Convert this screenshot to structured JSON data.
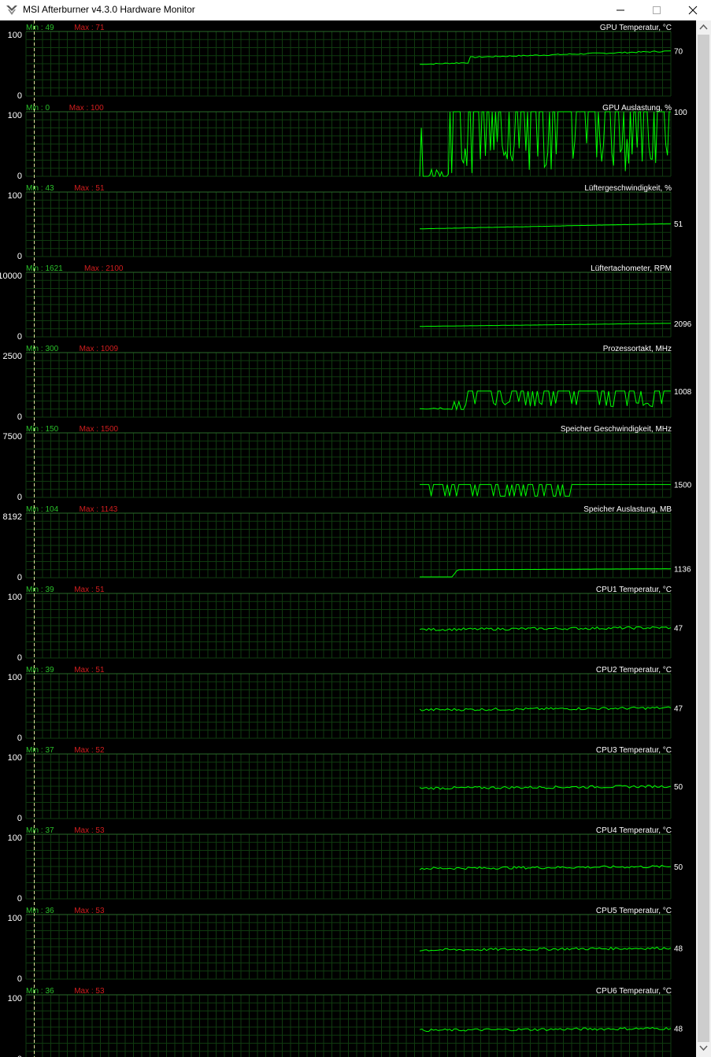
{
  "window": {
    "title": "MSI Afterburner v4.3.0 Hardware Monitor",
    "controls": {
      "minimize": "minimize",
      "maximize": "maximize",
      "close": "close"
    }
  },
  "colors": {
    "background": "#000000",
    "grid": "#0f3a0f",
    "line": "#00ff00",
    "min_text": "#29c029",
    "max_text": "#d21e1e",
    "label_text": "#ffffff"
  },
  "monitor": {
    "min_prefix": "Min : ",
    "max_prefix": "Max : ",
    "graphs": [
      {
        "name": "GPU Temperatur, °C",
        "min": "49",
        "max": "71",
        "scale_top": "100",
        "scale_bottom": "0",
        "current": "70",
        "current_value": 70,
        "range": [
          0,
          100
        ],
        "shape": "temp"
      },
      {
        "name": "GPU Auslastung, %",
        "min": "0",
        "max": "100",
        "scale_top": "100",
        "scale_bottom": "0",
        "current": "100",
        "current_value": 100,
        "range": [
          0,
          100
        ],
        "shape": "usage"
      },
      {
        "name": "Lüftergeschwindigkeit, %",
        "min": "43",
        "max": "51",
        "scale_top": "100",
        "scale_bottom": "0",
        "current": "51",
        "current_value": 51,
        "range": [
          0,
          100
        ],
        "shape": "fan"
      },
      {
        "name": "Lüftertachometer, RPM",
        "min": "1621",
        "max": "2100",
        "scale_top": "10000",
        "scale_bottom": "0",
        "current": "2096",
        "current_value": 2096,
        "range": [
          0,
          10000
        ],
        "shape": "fan"
      },
      {
        "name": "Prozessortakt, MHz",
        "min": "300",
        "max": "1009",
        "scale_top": "2500",
        "scale_bottom": "0",
        "current": "1008",
        "current_value": 1008,
        "range": [
          0,
          2500
        ],
        "shape": "clock"
      },
      {
        "name": "Speicher Geschwindigkeit, MHz",
        "min": "150",
        "max": "1500",
        "scale_top": "7500",
        "scale_bottom": "0",
        "current": "1500",
        "current_value": 1500,
        "range": [
          0,
          7500
        ],
        "shape": "memclock"
      },
      {
        "name": "Speicher Auslastung, MB",
        "min": "104",
        "max": "1143",
        "scale_top": "8192",
        "scale_bottom": "0",
        "current": "1136",
        "current_value": 1136,
        "range": [
          0,
          8192
        ],
        "shape": "memuse"
      },
      {
        "name": "CPU1 Temperatur, °C",
        "min": "39",
        "max": "51",
        "scale_top": "100",
        "scale_bottom": "0",
        "current": "47",
        "current_value": 47,
        "range": [
          0,
          100
        ],
        "shape": "cpu"
      },
      {
        "name": "CPU2 Temperatur, °C",
        "min": "39",
        "max": "51",
        "scale_top": "100",
        "scale_bottom": "0",
        "current": "47",
        "current_value": 47,
        "range": [
          0,
          100
        ],
        "shape": "cpu"
      },
      {
        "name": "CPU3 Temperatur, °C",
        "min": "37",
        "max": "52",
        "scale_top": "100",
        "scale_bottom": "0",
        "current": "50",
        "current_value": 50,
        "range": [
          0,
          100
        ],
        "shape": "cpu"
      },
      {
        "name": "CPU4 Temperatur, °C",
        "min": "37",
        "max": "53",
        "scale_top": "100",
        "scale_bottom": "0",
        "current": "50",
        "current_value": 50,
        "range": [
          0,
          100
        ],
        "shape": "cpu"
      },
      {
        "name": "CPU5 Temperatur, °C",
        "min": "36",
        "max": "53",
        "scale_top": "100",
        "scale_bottom": "0",
        "current": "48",
        "current_value": 48,
        "range": [
          0,
          100
        ],
        "shape": "cpu"
      },
      {
        "name": "CPU6 Temperatur, °C",
        "min": "36",
        "max": "53",
        "scale_top": "100",
        "scale_bottom": "0",
        "current": "48",
        "current_value": 48,
        "range": [
          0,
          100
        ],
        "shape": "cpu"
      }
    ]
  }
}
